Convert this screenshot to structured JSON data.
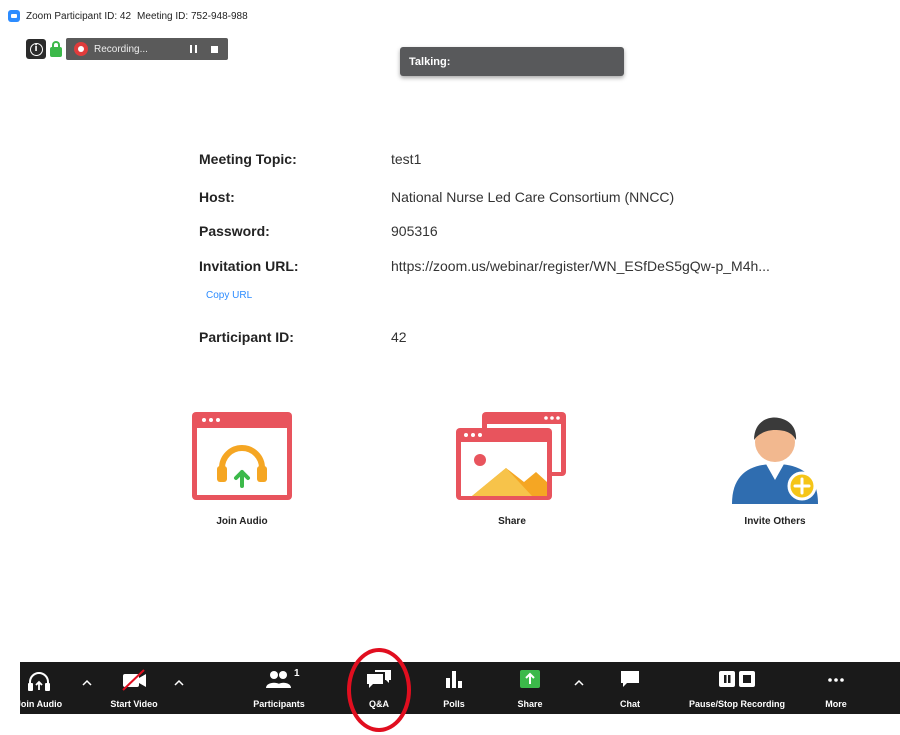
{
  "titlebar": {
    "participant_id_text": "Zoom Participant ID: 42",
    "meeting_id_text": "Meeting ID: 752-948-988"
  },
  "recording": {
    "status": "Recording..."
  },
  "talking": {
    "label": "Talking:"
  },
  "meeting_info": {
    "topic_label": "Meeting Topic:",
    "topic_value": "test1",
    "host_label": "Host:",
    "host_value": "National Nurse Led Care Consortium (NNCC)",
    "password_label": "Password:",
    "password_value": "905316",
    "url_label": "Invitation URL:",
    "url_value": "https://zoom.us/webinar/register/WN_ESfDeS5gQw-p_M4h...",
    "copy_url": "Copy URL",
    "participant_label": "Participant ID:",
    "participant_value": "42"
  },
  "actions": {
    "join_audio": "Join Audio",
    "share": "Share",
    "invite_others": "Invite Others"
  },
  "toolbar": {
    "join_audio": "Join Audio",
    "start_video": "Start Video",
    "participants": "Participants",
    "participants_count": "1",
    "qa": "Q&A",
    "polls": "Polls",
    "share": "Share",
    "chat": "Chat",
    "pause_stop_recording": "Pause/Stop Recording",
    "more": "More"
  },
  "colors": {
    "zoom_blue": "#2D8CFF",
    "toolbar_bg": "#1a1a1a",
    "share_green": "#3cb94a",
    "highlight_red": "#e10e1f",
    "icon_coral": "#e8545d"
  }
}
